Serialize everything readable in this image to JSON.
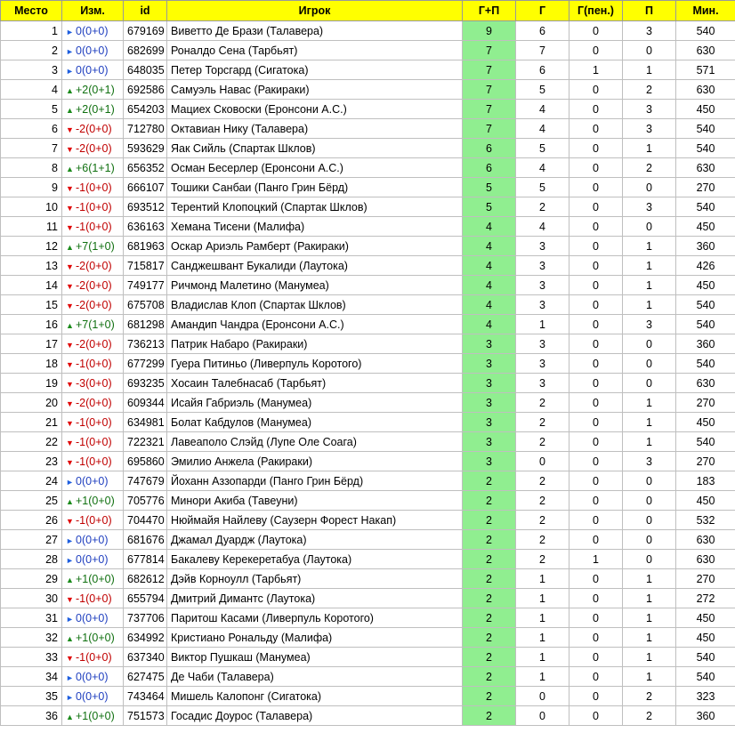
{
  "columns": [
    "Место",
    "Изм.",
    "id",
    "Игрок",
    "Г+П",
    "Г",
    "Г(пен.)",
    "П",
    "Мин."
  ],
  "rows": [
    {
      "place": "1",
      "dir": "same",
      "chg": "0(0+0)",
      "id": "679169",
      "player": "Виветто Де Брази (Талавера)",
      "gp": "9",
      "g": "6",
      "pen": "0",
      "a": "3",
      "min": "540"
    },
    {
      "place": "2",
      "dir": "same",
      "chg": "0(0+0)",
      "id": "682699",
      "player": "Роналдо Сена (Тарбьят)",
      "gp": "7",
      "g": "7",
      "pen": "0",
      "a": "0",
      "min": "630"
    },
    {
      "place": "3",
      "dir": "same",
      "chg": "0(0+0)",
      "id": "648035",
      "player": "Петер Торсгард (Сигатока)",
      "gp": "7",
      "g": "6",
      "pen": "1",
      "a": "1",
      "min": "571"
    },
    {
      "place": "4",
      "dir": "up",
      "chg": "+2(0+1)",
      "id": "692586",
      "player": "Самуэль Навас (Ракираки)",
      "gp": "7",
      "g": "5",
      "pen": "0",
      "a": "2",
      "min": "630"
    },
    {
      "place": "5",
      "dir": "up",
      "chg": "+2(0+1)",
      "id": "654203",
      "player": "Мациех Сковоски (Еронсони А.С.)",
      "gp": "7",
      "g": "4",
      "pen": "0",
      "a": "3",
      "min": "450"
    },
    {
      "place": "6",
      "dir": "down",
      "chg": "-2(0+0)",
      "id": "712780",
      "player": "Октавиан Нику (Талавера)",
      "gp": "7",
      "g": "4",
      "pen": "0",
      "a": "3",
      "min": "540"
    },
    {
      "place": "7",
      "dir": "down",
      "chg": "-2(0+0)",
      "id": "593629",
      "player": "Яак Сийль (Спартак Шклов)",
      "gp": "6",
      "g": "5",
      "pen": "0",
      "a": "1",
      "min": "540"
    },
    {
      "place": "8",
      "dir": "up",
      "chg": "+6(1+1)",
      "id": "656352",
      "player": "Осман Бесерлер (Еронсони А.С.)",
      "gp": "6",
      "g": "4",
      "pen": "0",
      "a": "2",
      "min": "630"
    },
    {
      "place": "9",
      "dir": "down",
      "chg": "-1(0+0)",
      "id": "666107",
      "player": "Тошики Санбаи (Панго Грин Бёрд)",
      "gp": "5",
      "g": "5",
      "pen": "0",
      "a": "0",
      "min": "270"
    },
    {
      "place": "10",
      "dir": "down",
      "chg": "-1(0+0)",
      "id": "693512",
      "player": "Терентий Клопоцкий (Спартак Шклов)",
      "gp": "5",
      "g": "2",
      "pen": "0",
      "a": "3",
      "min": "540"
    },
    {
      "place": "11",
      "dir": "down",
      "chg": "-1(0+0)",
      "id": "636163",
      "player": "Хемана Тисени (Малифа)",
      "gp": "4",
      "g": "4",
      "pen": "0",
      "a": "0",
      "min": "450"
    },
    {
      "place": "12",
      "dir": "up",
      "chg": "+7(1+0)",
      "id": "681963",
      "player": "Оскар Ариэль Рамберт (Ракираки)",
      "gp": "4",
      "g": "3",
      "pen": "0",
      "a": "1",
      "min": "360"
    },
    {
      "place": "13",
      "dir": "down",
      "chg": "-2(0+0)",
      "id": "715817",
      "player": "Санджешвант Букалиди (Лаутока)",
      "gp": "4",
      "g": "3",
      "pen": "0",
      "a": "1",
      "min": "426"
    },
    {
      "place": "14",
      "dir": "down",
      "chg": "-2(0+0)",
      "id": "749177",
      "player": "Ричмонд Малетино (Манумеа)",
      "gp": "4",
      "g": "3",
      "pen": "0",
      "a": "1",
      "min": "450"
    },
    {
      "place": "15",
      "dir": "down",
      "chg": "-2(0+0)",
      "id": "675708",
      "player": "Владислав Клоп (Спартак Шклов)",
      "gp": "4",
      "g": "3",
      "pen": "0",
      "a": "1",
      "min": "540"
    },
    {
      "place": "16",
      "dir": "up",
      "chg": "+7(1+0)",
      "id": "681298",
      "player": "Амандип Чандра (Еронсони А.С.)",
      "gp": "4",
      "g": "1",
      "pen": "0",
      "a": "3",
      "min": "540"
    },
    {
      "place": "17",
      "dir": "down",
      "chg": "-2(0+0)",
      "id": "736213",
      "player": "Патрик Набаро (Ракираки)",
      "gp": "3",
      "g": "3",
      "pen": "0",
      "a": "0",
      "min": "360"
    },
    {
      "place": "18",
      "dir": "down",
      "chg": "-1(0+0)",
      "id": "677299",
      "player": "Гуера Питиньо (Ливерпуль Коротого)",
      "gp": "3",
      "g": "3",
      "pen": "0",
      "a": "0",
      "min": "540"
    },
    {
      "place": "19",
      "dir": "down",
      "chg": "-3(0+0)",
      "id": "693235",
      "player": "Хосаин Талебнасаб (Тарбьят)",
      "gp": "3",
      "g": "3",
      "pen": "0",
      "a": "0",
      "min": "630"
    },
    {
      "place": "20",
      "dir": "down",
      "chg": "-2(0+0)",
      "id": "609344",
      "player": "Исайя Габриэль (Манумеа)",
      "gp": "3",
      "g": "2",
      "pen": "0",
      "a": "1",
      "min": "270"
    },
    {
      "place": "21",
      "dir": "down",
      "chg": "-1(0+0)",
      "id": "634981",
      "player": "Болат Кабдулов (Манумеа)",
      "gp": "3",
      "g": "2",
      "pen": "0",
      "a": "1",
      "min": "450"
    },
    {
      "place": "22",
      "dir": "down",
      "chg": "-1(0+0)",
      "id": "722321",
      "player": "Лавеаполо Слэйд (Лупе Оле Соага)",
      "gp": "3",
      "g": "2",
      "pen": "0",
      "a": "1",
      "min": "540"
    },
    {
      "place": "23",
      "dir": "down",
      "chg": "-1(0+0)",
      "id": "695860",
      "player": "Эмилио Анжела (Ракираки)",
      "gp": "3",
      "g": "0",
      "pen": "0",
      "a": "3",
      "min": "270"
    },
    {
      "place": "24",
      "dir": "same",
      "chg": "0(0+0)",
      "id": "747679",
      "player": "Йоханн Аззопарди (Панго Грин Бёрд)",
      "gp": "2",
      "g": "2",
      "pen": "0",
      "a": "0",
      "min": "183"
    },
    {
      "place": "25",
      "dir": "up",
      "chg": "+1(0+0)",
      "id": "705776",
      "player": "Минори Акиба (Тавеуни)",
      "gp": "2",
      "g": "2",
      "pen": "0",
      "a": "0",
      "min": "450"
    },
    {
      "place": "26",
      "dir": "down",
      "chg": "-1(0+0)",
      "id": "704470",
      "player": "Нюймайя Найлеву (Саузерн Форест Накап)",
      "gp": "2",
      "g": "2",
      "pen": "0",
      "a": "0",
      "min": "532"
    },
    {
      "place": "27",
      "dir": "same",
      "chg": "0(0+0)",
      "id": "681676",
      "player": "Джамал Дуардж (Лаутока)",
      "gp": "2",
      "g": "2",
      "pen": "0",
      "a": "0",
      "min": "630"
    },
    {
      "place": "28",
      "dir": "same",
      "chg": "0(0+0)",
      "id": "677814",
      "player": "Бакалеву Керекеретабуа (Лаутока)",
      "gp": "2",
      "g": "2",
      "pen": "1",
      "a": "0",
      "min": "630"
    },
    {
      "place": "29",
      "dir": "up",
      "chg": "+1(0+0)",
      "id": "682612",
      "player": "Дэйв Корноулл (Тарбьят)",
      "gp": "2",
      "g": "1",
      "pen": "0",
      "a": "1",
      "min": "270"
    },
    {
      "place": "30",
      "dir": "down",
      "chg": "-1(0+0)",
      "id": "655794",
      "player": "Дмитрий Димантс (Лаутока)",
      "gp": "2",
      "g": "1",
      "pen": "0",
      "a": "1",
      "min": "272"
    },
    {
      "place": "31",
      "dir": "same",
      "chg": "0(0+0)",
      "id": "737706",
      "player": "Паритош Касами (Ливерпуль Коротого)",
      "gp": "2",
      "g": "1",
      "pen": "0",
      "a": "1",
      "min": "450"
    },
    {
      "place": "32",
      "dir": "up",
      "chg": "+1(0+0)",
      "id": "634992",
      "player": "Кристиано Рональду (Малифа)",
      "gp": "2",
      "g": "1",
      "pen": "0",
      "a": "1",
      "min": "450"
    },
    {
      "place": "33",
      "dir": "down",
      "chg": "-1(0+0)",
      "id": "637340",
      "player": "Виктор Пушкаш (Манумеа)",
      "gp": "2",
      "g": "1",
      "pen": "0",
      "a": "1",
      "min": "540"
    },
    {
      "place": "34",
      "dir": "same",
      "chg": "0(0+0)",
      "id": "627475",
      "player": "Де Чаби (Талавера)",
      "gp": "2",
      "g": "1",
      "pen": "0",
      "a": "1",
      "min": "540"
    },
    {
      "place": "35",
      "dir": "same",
      "chg": "0(0+0)",
      "id": "743464",
      "player": "Мишель Калопонг (Сигатока)",
      "gp": "2",
      "g": "0",
      "pen": "0",
      "a": "2",
      "min": "323"
    },
    {
      "place": "36",
      "dir": "up",
      "chg": "+1(0+0)",
      "id": "751573",
      "player": "Госадис Доурос (Талавера)",
      "gp": "2",
      "g": "0",
      "pen": "0",
      "a": "2",
      "min": "360"
    }
  ],
  "icons": {
    "up": "▲",
    "down": "▼",
    "same": "►"
  },
  "colors": {
    "header_bg": "#ffff00",
    "gp_bg": "#90ee90",
    "up": "#1a8a1a",
    "down": "#e00000",
    "same": "#1f5fdf"
  }
}
